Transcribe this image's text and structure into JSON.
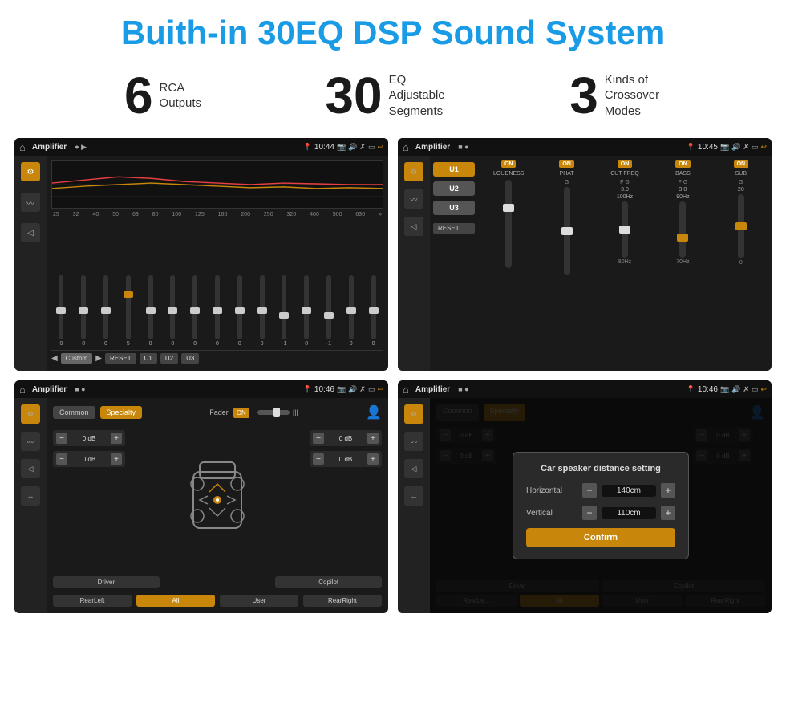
{
  "header": {
    "title": "Buith-in 30EQ DSP Sound System"
  },
  "stats": [
    {
      "number": "6",
      "label": "RCA\nOutputs"
    },
    {
      "number": "30",
      "label": "EQ Adjustable\nSegments"
    },
    {
      "number": "3",
      "label": "Kinds of\nCrossover Modes"
    }
  ],
  "screens": [
    {
      "id": "screen1",
      "app_name": "Amplifier",
      "time": "10:44",
      "type": "eq"
    },
    {
      "id": "screen2",
      "app_name": "Amplifier",
      "time": "10:45",
      "type": "amp"
    },
    {
      "id": "screen3",
      "app_name": "Amplifier",
      "time": "10:46",
      "type": "common"
    },
    {
      "id": "screen4",
      "app_name": "Amplifier",
      "time": "10:46",
      "type": "dialog"
    }
  ],
  "eq": {
    "frequencies": [
      "25",
      "32",
      "40",
      "50",
      "63",
      "80",
      "100",
      "125",
      "160",
      "200",
      "250",
      "320",
      "400",
      "500",
      "630"
    ],
    "values": [
      "0",
      "0",
      "0",
      "5",
      "0",
      "0",
      "0",
      "0",
      "0",
      "0",
      "-1",
      "0",
      "-1",
      "0",
      "0"
    ],
    "preset": "Custom",
    "buttons": [
      "RESET",
      "U1",
      "U2",
      "U3"
    ]
  },
  "amp": {
    "channels": [
      "U1",
      "U2",
      "U3"
    ],
    "controls": [
      "LOUDNESS",
      "PHAT",
      "CUT FREQ",
      "BASS",
      "SUB"
    ],
    "reset": "RESET"
  },
  "common": {
    "tabs": [
      "Common",
      "Specialty"
    ],
    "fader_label": "Fader",
    "fader_on": "ON",
    "db_values": [
      "0 dB",
      "0 dB",
      "0 dB",
      "0 dB"
    ],
    "bottom_buttons": [
      "Driver",
      "",
      "Copilot",
      "RearLeft",
      "All",
      "",
      "User",
      "RearRight"
    ]
  },
  "dialog": {
    "title": "Car speaker distance setting",
    "horizontal_label": "Horizontal",
    "horizontal_value": "140cm",
    "vertical_label": "Vertical",
    "vertical_value": "110cm",
    "confirm_label": "Confirm",
    "tabs": [
      "Common",
      "Specialty"
    ],
    "bottom_buttons": [
      "Driver",
      "Copilot",
      "RearLeft",
      "All",
      "User",
      "RearRight"
    ]
  }
}
